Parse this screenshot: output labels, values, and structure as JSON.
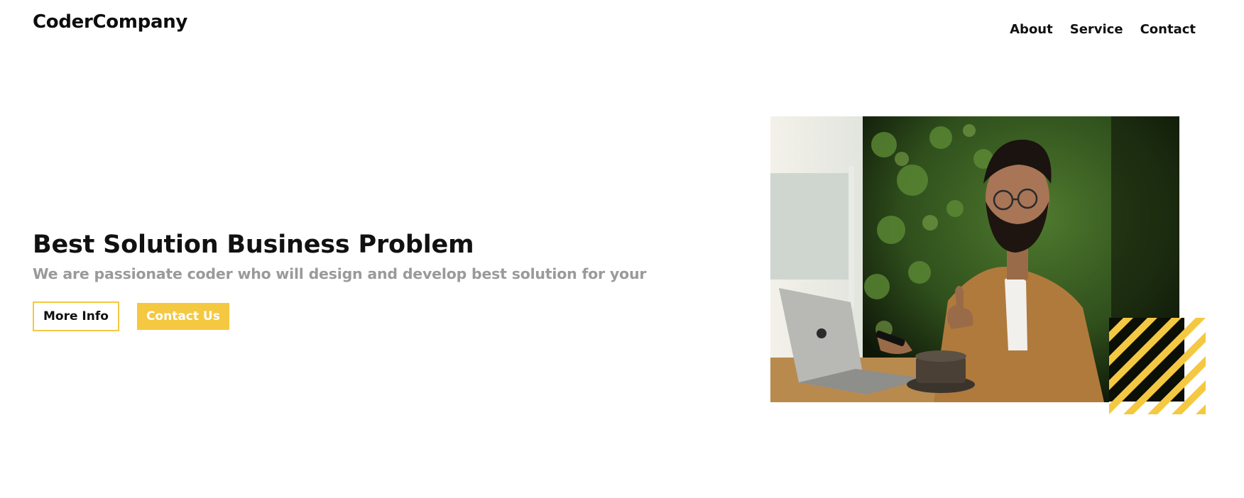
{
  "header": {
    "brand": "CoderCompany",
    "nav": [
      "About",
      "Service",
      "Contact"
    ]
  },
  "hero": {
    "title": "Best Solution Business Problem",
    "subtitle": "We are passionate coder who will design and develop best solution for your",
    "buttons": {
      "more_info": "More Info",
      "contact_us": "Contact Us"
    },
    "image_subject": "man-with-laptop-photo"
  },
  "colors": {
    "accent": "#f5c842",
    "text": "#111111",
    "muted": "#9a9a9a",
    "background": "#ffffff"
  }
}
